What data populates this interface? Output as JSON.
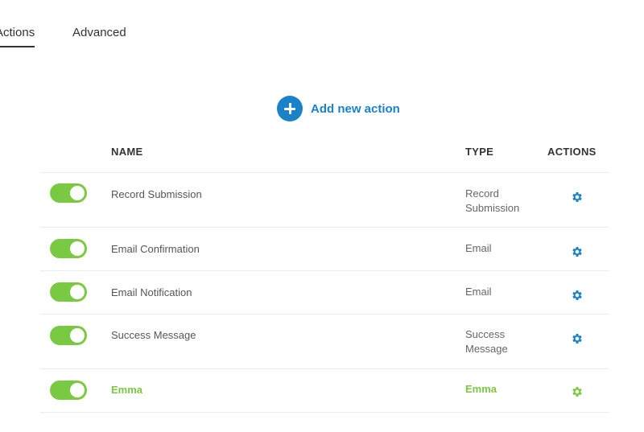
{
  "tabs": [
    {
      "label": "Actions",
      "active": true
    },
    {
      "label": "Advanced",
      "active": false
    }
  ],
  "add_action": {
    "label": "Add new action",
    "icon": "plus-circle-icon",
    "color": "#1a82c9"
  },
  "table": {
    "headers": {
      "name": "NAME",
      "type": "TYPE",
      "actions": "ACTIONS"
    },
    "rows": [
      {
        "enabled": true,
        "name": "Record Submission",
        "type": "Record Submission",
        "icon": "gear-icon"
      },
      {
        "enabled": true,
        "name": "Email Confirmation",
        "type": "Email",
        "icon": "gear-icon"
      },
      {
        "enabled": true,
        "name": "Email Notification",
        "type": "Email",
        "icon": "gear-icon"
      },
      {
        "enabled": true,
        "name": "Success Message",
        "type": "Success Message",
        "icon": "gear-icon"
      },
      {
        "enabled": true,
        "name": "Emma",
        "type": "Emma",
        "icon": "gear-icon",
        "highlighted": true
      }
    ]
  },
  "colors": {
    "accent_blue": "#1a82c9",
    "toggle_green": "#7ac943",
    "highlight_green": "#7ac943",
    "text_dark": "#333333"
  }
}
